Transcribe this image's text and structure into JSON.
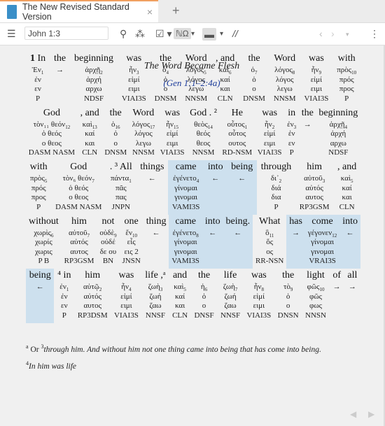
{
  "tab": {
    "title": "The New Revised Standard Version",
    "close": "×",
    "new": "+"
  },
  "toolbar": {
    "reference": "John 1:3"
  },
  "heading": "The Word Became Flesh",
  "xref": "(Gen 1:1–2:4a)",
  "accent": "#cde0ee",
  "lines": [
    [
      {
        "en": "In",
        "v": "1",
        "g": [
          "Ἐν",
          "1",
          "ἐν",
          "εν",
          "P"
        ]
      },
      {
        "en": "the",
        "g": [
          "→",
          "",
          "",
          "",
          ""
        ]
      },
      {
        "en": "beginning",
        "g": [
          "ἀρχῇ",
          "2",
          "ἀρχή",
          "αρχω",
          "NDSF"
        ]
      },
      {
        "en": "was",
        "g": [
          "ἦν",
          "3",
          "εἰμί",
          "ειμι",
          "VIAI3S"
        ]
      },
      {
        "en": "the",
        "g": [
          "ὁ",
          "4",
          "ὁ",
          "ο",
          "DNSM"
        ]
      },
      {
        "en": "Word",
        "g": [
          "λόγος",
          "5",
          "λόγος",
          "λεγω",
          "NNSM"
        ]
      },
      {
        "en": ", and",
        "g": [
          "καὶ",
          "6",
          "καί",
          "και",
          "CLN"
        ]
      },
      {
        "en": "the",
        "g": [
          "ὁ",
          "7",
          "ὁ",
          "ο",
          "DNSM"
        ]
      },
      {
        "en": "Word",
        "g": [
          "λόγος",
          "8",
          "λόγος",
          "λεγω",
          "NNSM"
        ]
      },
      {
        "en": "was",
        "g": [
          "ἦν",
          "9",
          "εἰμί",
          "ειμι",
          "VIAI3S"
        ]
      },
      {
        "en": "with",
        "g": [
          "πρὸς",
          "10",
          "πρός",
          "προς",
          "P"
        ]
      }
    ],
    [
      {
        "en": "God",
        "g": [
          "τὸν₁₁ θεόν",
          "12",
          "ὁ θεός",
          "ο θεος",
          "DASM NASM"
        ]
      },
      {
        "en": ", and",
        "g": [
          "καὶ",
          "13",
          "καί",
          "και",
          "CLN"
        ]
      },
      {
        "en": "the",
        "g": [
          "ὁ",
          "16",
          "ὁ",
          "ο",
          "DNSM"
        ]
      },
      {
        "en": "Word",
        "g": [
          "λόγος",
          "17",
          "λόγος",
          "λεγω",
          "NNSM"
        ]
      },
      {
        "en": "was",
        "g": [
          "ἦν",
          "15",
          "εἰμί",
          "ειμι",
          "VIAI3S"
        ]
      },
      {
        "en": "God . ²",
        "g": [
          "θεὸς",
          "14",
          "θεός",
          "θεος",
          "NNSM"
        ]
      },
      {
        "en": "He",
        "g": [
          "οὗτος",
          "1",
          "οὗτος",
          "ουτος",
          "RD-NSM"
        ]
      },
      {
        "en": "was",
        "g": [
          "ἦν",
          "2",
          "εἰμί",
          "ειμι",
          "VIAI3S"
        ]
      },
      {
        "en": "in",
        "g": [
          "ἐν",
          "3",
          "ἐν",
          "εν",
          "P"
        ]
      },
      {
        "en": "the",
        "g": [
          "→",
          "",
          "",
          "",
          ""
        ]
      },
      {
        "en": "beginning",
        "g": [
          "ἀρχῇ",
          "4",
          "ἀρχή",
          "αρχω",
          "NDSF"
        ]
      }
    ],
    [
      {
        "en": "with",
        "g": [
          "πρὸς",
          "5",
          "πρός",
          "προς",
          "P"
        ]
      },
      {
        "en": "God",
        "g": [
          "τὸν₆ θεόν",
          "7",
          "ὁ θεός",
          "ο θεος",
          "DASM NASM"
        ]
      },
      {
        "en": ". ³ All",
        "g": [
          "πάντα",
          "1",
          "πᾶς",
          "πας",
          "JNPN"
        ]
      },
      {
        "en": "things",
        "g": [
          "←",
          "",
          "",
          "",
          ""
        ]
      },
      {
        "en": "came",
        "hl": true,
        "g": [
          "ἐγένετο",
          "4",
          "γίνομαι",
          "γινομαι",
          "VAMI3S"
        ]
      },
      {
        "en": "into",
        "hl": true,
        "g": [
          "←",
          "",
          "",
          "",
          ""
        ]
      },
      {
        "en": "being",
        "hl": true,
        "g": [
          "←",
          "",
          "",
          "",
          ""
        ]
      },
      {
        "en": "through",
        "g": [
          "δι᾽",
          "2",
          "διά",
          "δια",
          "P"
        ]
      },
      {
        "en": "him",
        "g": [
          "αὐτοῦ",
          "3",
          "αὐτός",
          "αυτος",
          "RP3GSM"
        ]
      },
      {
        "en": ", and",
        "g": [
          "καὶ",
          "5",
          "καί",
          "και",
          "CLN"
        ]
      }
    ],
    [
      {
        "en": "without",
        "g": [
          "χωρὶς",
          "6",
          "χωρίς",
          "χωρις",
          "P B"
        ]
      },
      {
        "en": "him",
        "g": [
          "αὐτοῦ",
          "7",
          "αὐτός",
          "αυτος",
          "RP3GSM"
        ]
      },
      {
        "en": "not",
        "g": [
          "οὐδὲ",
          "9",
          "οὐδέ",
          "δε ου",
          "BN"
        ]
      },
      {
        "en": "one",
        "g": [
          "ἕν",
          "10",
          "εἷς",
          "εις 2",
          "JNSN"
        ]
      },
      {
        "en": "thing",
        "g": [
          "←",
          "",
          "",
          "",
          ""
        ]
      },
      {
        "en": "came",
        "hl": true,
        "g": [
          "ἐγένετο",
          "8",
          "γίνομαι",
          "γινομαι",
          "VAMI3S"
        ]
      },
      {
        "en": "into",
        "hl": true,
        "g": [
          "←",
          "",
          "",
          "",
          ""
        ]
      },
      {
        "en": "being.",
        "hl": true,
        "g": [
          "←",
          "",
          "",
          "",
          ""
        ]
      },
      {
        "en": "What",
        "g": [
          "ὃ",
          "11",
          "ὅς",
          "ος",
          "RR-NSN"
        ]
      },
      {
        "en": "has",
        "hl": true,
        "g": [
          "→",
          "",
          "",
          "",
          ""
        ]
      },
      {
        "en": "come",
        "hl": true,
        "g": [
          "γέγονεν",
          "12",
          "γίνομαι",
          "γινομαι",
          "VRAI3S"
        ]
      },
      {
        "en": "into",
        "hl": true,
        "g": [
          "←",
          "",
          "",
          "",
          ""
        ]
      }
    ],
    [
      {
        "en": "being",
        "hl": true,
        "g": [
          "←",
          "",
          "",
          "",
          ""
        ]
      },
      {
        "en": "⁴ in",
        "g": [
          "ἐν",
          "1",
          "ἐν",
          "εν",
          "P"
        ]
      },
      {
        "en": "him",
        "g": [
          "αὐτῷ",
          "2",
          "αὐτός",
          "αυτος",
          "RP3DSM"
        ]
      },
      {
        "en": "was",
        "g": [
          "ἦν",
          "4",
          "εἰμί",
          "ειμι",
          "VIAI3S"
        ]
      },
      {
        "en": "life ,ᵃ",
        "g": [
          "ζωὴ",
          "3",
          "ζωή",
          "ζαω",
          "NNSF"
        ]
      },
      {
        "en": "and",
        "g": [
          "καὶ",
          "5",
          "καί",
          "και",
          "CLN"
        ]
      },
      {
        "en": "the",
        "g": [
          "ἡ",
          "6",
          "ὁ",
          "ο",
          "DNSF"
        ]
      },
      {
        "en": "life",
        "g": [
          "ζωὴ",
          "7",
          "ζωή",
          "ζαω",
          "NNSF"
        ]
      },
      {
        "en": "was",
        "g": [
          "ἦν",
          "8",
          "εἰμί",
          "ειμι",
          "VIAI3S"
        ]
      },
      {
        "en": "the",
        "g": [
          "τὸ",
          "9",
          "ὁ",
          "ο",
          "DNSN"
        ]
      },
      {
        "en": "light",
        "g": [
          "φῶς",
          "10",
          "φῶς",
          "φως",
          "NNSN"
        ]
      },
      {
        "en": "of",
        "g": [
          "→",
          "",
          "",
          "",
          ""
        ]
      },
      {
        "en": "all",
        "g": [
          "→",
          "",
          "",
          "",
          ""
        ]
      }
    ]
  ],
  "footnote": {
    "mark": "a",
    "lead": "Or ",
    "v3": "3",
    "text1": "through him. And without him not one thing came into being that has come into being.",
    "v4": "4",
    "text2": "In him was life"
  }
}
